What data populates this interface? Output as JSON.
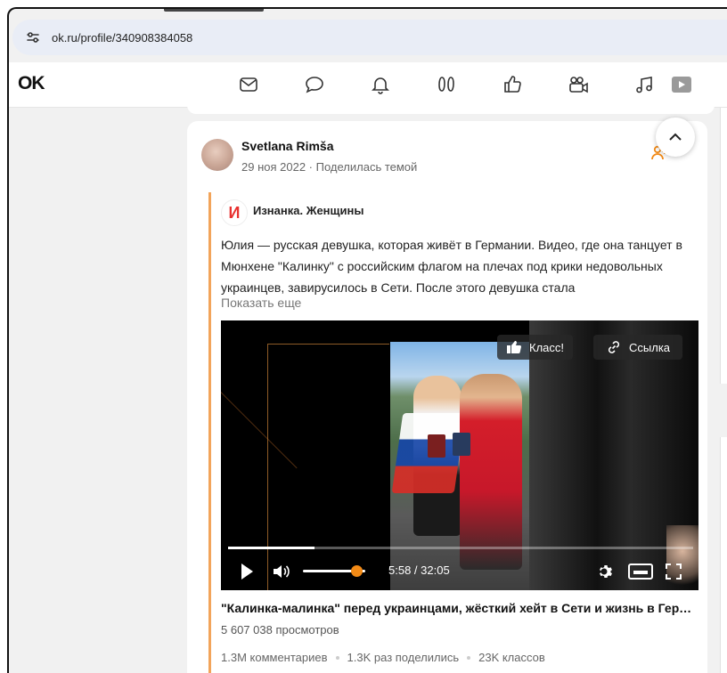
{
  "browser": {
    "url": "ok.ru/profile/340908384058"
  },
  "header": {
    "logo": "OK",
    "nav_icons": [
      "mail-icon",
      "chat-icon",
      "bell-icon",
      "guests-icon",
      "like-icon",
      "video-camera-icon",
      "music-icon",
      "video-icon"
    ]
  },
  "post": {
    "author": "Svetlana Rimša",
    "meta": "29 ноя 2022 · Поделилась темой",
    "group_logo": "И",
    "group_name": "Изнанка. Женщины",
    "text": "Юлия — русская девушка, которая живёт в Германии. Видео, где она танцует в Мюнхене \"Калинку\" с российским флагом на плечах под крики недовольных украинцев, завирусилось в Сети. После этого девушка стала",
    "show_more": "Показать еще",
    "video": {
      "like_label": "Класс!",
      "link_label": "Ссылка",
      "time": "5:58 / 32:05",
      "progress": 0.186,
      "volume": 0.85
    },
    "video_title": "\"Калинка-малинка\" перед украинцами, жёсткий хейт в Сети и жизнь в Германии",
    "views": "5 607 038 просмотров",
    "stats": {
      "comments": "1.3M комментариев",
      "shares": "1.3K раз поделились",
      "likes": "23K классов"
    }
  },
  "colors": {
    "accent": "#f28a16",
    "share_border": "#f2a45a",
    "group_logo": "#e8312f"
  }
}
